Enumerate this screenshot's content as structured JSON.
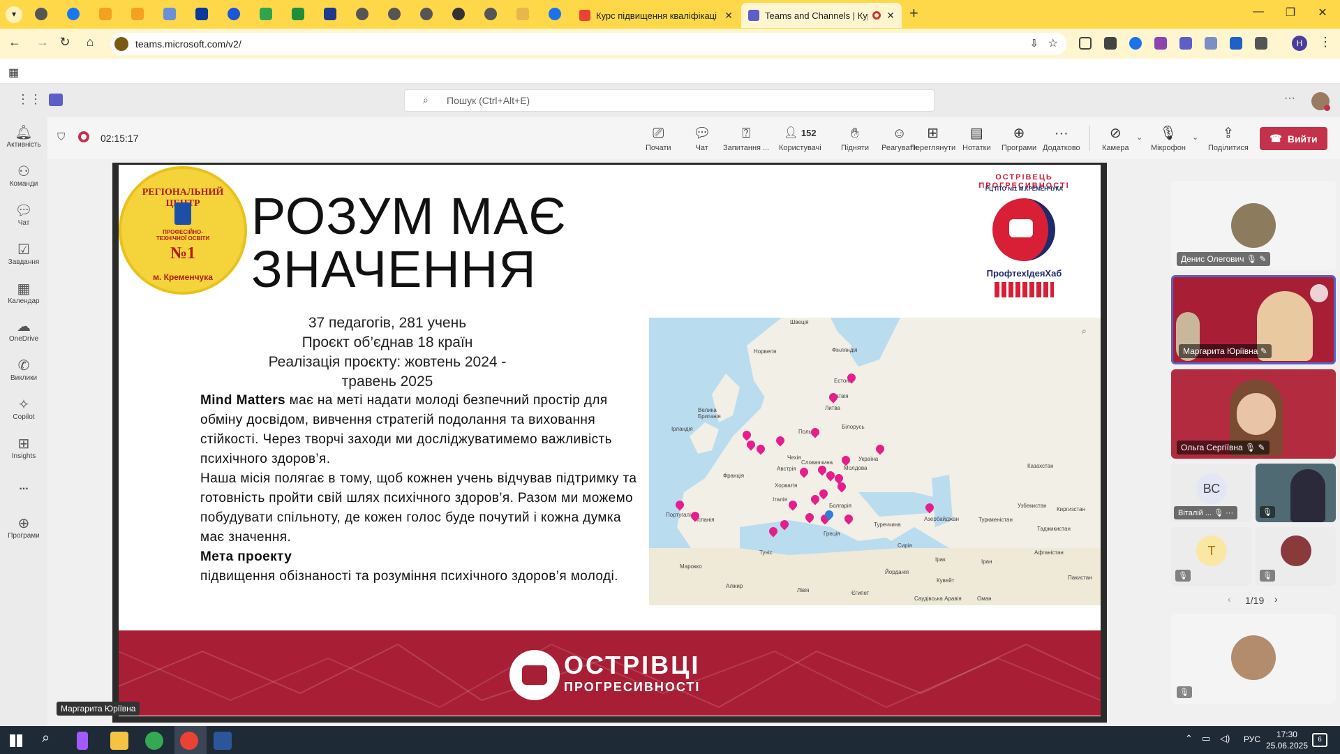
{
  "browser": {
    "tabs": [
      {
        "title": "Курс підвищення кваліфікаці",
        "active": false
      },
      {
        "title": "Teams and Channels | Курс",
        "active": true
      }
    ],
    "url": "teams.microsoft.com/v2/",
    "profile_initial": "H"
  },
  "teams": {
    "search_placeholder": "Пошук (Ctrl+Alt+E)",
    "rail": [
      {
        "label": "Активність",
        "icon": "bell-icon"
      },
      {
        "label": "Команди",
        "icon": "teams-icon"
      },
      {
        "label": "Чат",
        "icon": "chat-icon"
      },
      {
        "label": "Завдання",
        "icon": "tasks-icon"
      },
      {
        "label": "Календар",
        "icon": "calendar-icon"
      },
      {
        "label": "OneDrive",
        "icon": "cloud-icon"
      },
      {
        "label": "Виклики",
        "icon": "phone-icon"
      },
      {
        "label": "Copilot",
        "icon": "copilot-icon"
      },
      {
        "label": "Insights",
        "icon": "insights-icon"
      },
      {
        "label": "...",
        "icon": "more-icon"
      },
      {
        "label": "Програми",
        "icon": "apps-icon"
      }
    ]
  },
  "meeting": {
    "timer": "02:15:17",
    "controls": [
      {
        "label": "Почати",
        "icon": "present-icon"
      },
      {
        "label": "Чат",
        "icon": "chat-icon"
      },
      {
        "label": "Запитання ...",
        "icon": "qa-icon"
      },
      {
        "label": "Користувачі",
        "icon": "people-icon",
        "count": "152"
      },
      {
        "label": "Підняти",
        "icon": "hand-icon"
      },
      {
        "label": "Реагувати",
        "icon": "smile-icon"
      },
      {
        "label": "Переглянути",
        "icon": "grid-icon"
      },
      {
        "label": "Нотатки",
        "icon": "notes-icon"
      },
      {
        "label": "Програми",
        "icon": "add-app-icon"
      },
      {
        "label": "Додатково",
        "icon": "more-icon"
      },
      {
        "label": "Камера",
        "icon": "camera-off-icon"
      },
      {
        "label": "Мікрофон",
        "icon": "mic-off-icon"
      },
      {
        "label": "Поділитися",
        "icon": "share-icon"
      }
    ],
    "leave_label": "Вийти",
    "presenter_label": "Маргарита Юріївна"
  },
  "slide": {
    "title_line1": "РОЗУМ МАЄ",
    "title_line2": "ЗНАЧЕННЯ",
    "logo_left_text": "РЕГІОНАЛЬНИЙ ЦЕНТР",
    "logo_left_inner": "ПРОФЕСІЙНО-ТЕХНІЧНОЇ ОСВІТИ",
    "logo_left_num": "№1",
    "logo_left_city": "м. Кременчука",
    "logo_right_arc": "ОСТРІВЕЦЬ ПРОГРЕСИВНОСТІ",
    "logo_right_inner": "РЦ ПТО №1 М.КРЕМЕНЧУКА",
    "logo_right_hub": "ПрофтехІдеяХаб",
    "stats": [
      "37 педагогів, 281 учень",
      "Проєкт об’єднав 18 країн",
      "Реалізація проєкту: жовтень 2024 -",
      "травень 2025"
    ],
    "para1_bold": "Mind Matters",
    "para1": " має на меті надати молоді безпечний простір для обміну досвідом, вивчення стратегій подолання та виховання стійкості. Через творчі заходи ми досліджуватимемо важливість психічного здоров’я.",
    "para2": "Наша місія полягає в тому, щоб кожнен учень відчував підтримку та готовність пройти свій шлях психічного здоров’я. Разом ми можемо побудувати спільноту, де кожен голос буде почутий і кожна думка має значення.",
    "goal_title": " Мета проекту",
    "goal_text": "підвищення обізнаності та розуміння психічного здоров’я молоді.",
    "map_labels": [
      "Швеція",
      "Фінляндія",
      "Норвегія",
      "Естонія",
      "Латвія",
      "Литва",
      "Велика Британія",
      "Ірландія",
      "Білорусь",
      "Польща",
      "Чехія",
      "Україна",
      "Франція",
      "Австрія",
      "Словаччина",
      "Молдова",
      "Хорватія",
      "Італія",
      "Іспанія",
      "Португалія",
      "Болгарія",
      "Казахстан",
      "Узбекистан",
      "Туреччина",
      "Сирія",
      "Ірак",
      "Іран",
      "Туркменістан",
      "Афганістан",
      "Пакистан",
      "Марокко",
      "Алжир",
      "Лівія",
      "Єгипет",
      "Азербайджан",
      "Киргизстан",
      "Таджикистан",
      "Туніс",
      "Греція",
      "Кувейт",
      "Йорданія",
      "Оман",
      "Саудівська Аравія"
    ],
    "banner_line1": "ОСТРІВЦІ",
    "banner_line2": "ПРОГРЕСИВНОСТІ"
  },
  "participants": [
    {
      "name": "Денис Олегович",
      "muted": true
    },
    {
      "name": "Маргарита Юріївна",
      "muted": false
    },
    {
      "name": "Ольга Сергіївна",
      "muted": true
    },
    {
      "name": "Віталій ...",
      "initials": "ВС",
      "muted": true
    },
    {
      "name": "",
      "muted": true
    },
    {
      "name": "",
      "initials": "T",
      "muted": true
    },
    {
      "name": "",
      "muted": true
    },
    {
      "name": "",
      "muted": true
    }
  ],
  "pager": "1/19",
  "taskbar": {
    "lang": "РУС",
    "time": "17:30",
    "date": "25.06.2025",
    "notif": "6"
  },
  "colors": {
    "chrome_tab_bar": "#ffd84a",
    "teams_purple": "#5b5fc7",
    "leave_red": "#c4314b",
    "slide_red": "#a81f35",
    "map_pin": "#e61e8c"
  }
}
